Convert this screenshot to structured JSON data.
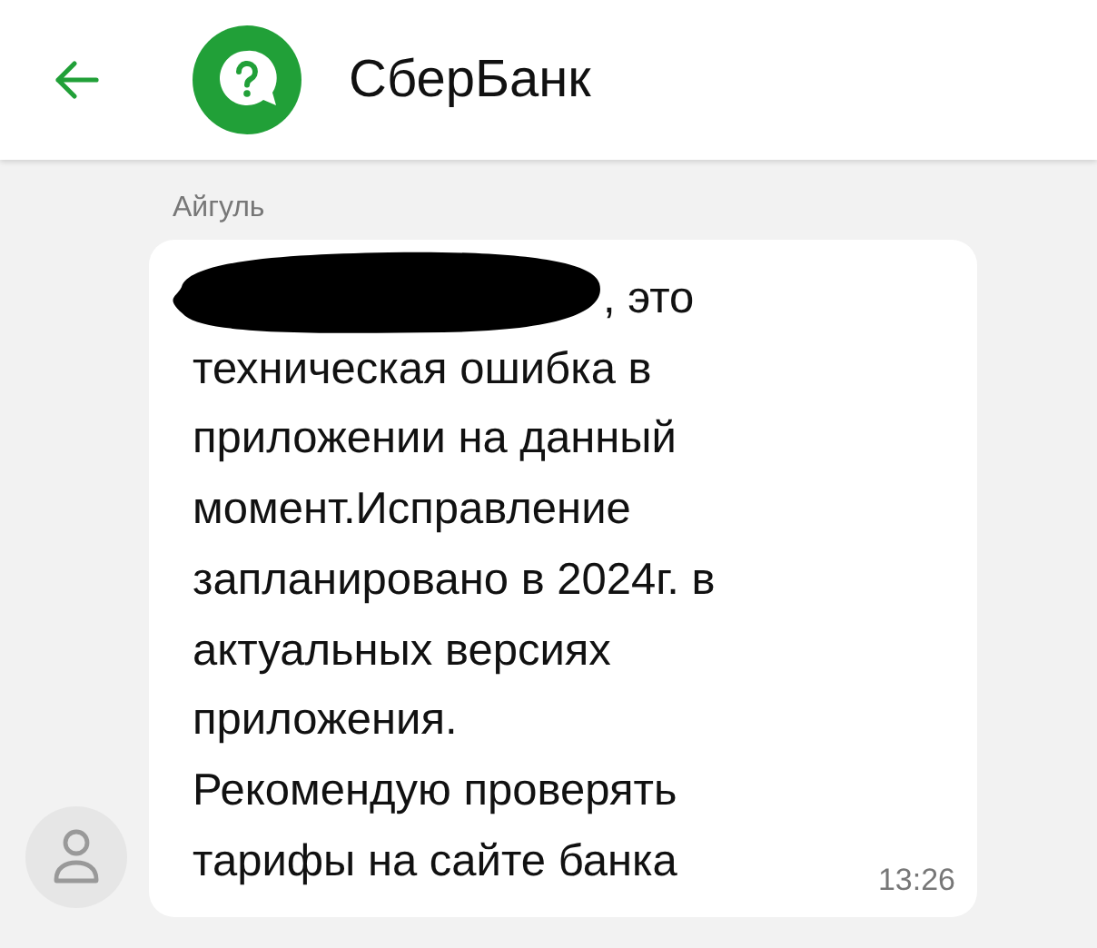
{
  "header": {
    "title": "СберБанк"
  },
  "message": {
    "sender": "Айгуль",
    "lines": [
      ", это",
      "техническая ошибка в",
      "приложении на данный",
      "момент.Исправление",
      "запланировано в 2024г. в",
      "актуальных версиях",
      "приложения.",
      "Рекомендую проверять",
      "тарифы на сайте банка"
    ],
    "redacted": true,
    "time": "13:26"
  }
}
